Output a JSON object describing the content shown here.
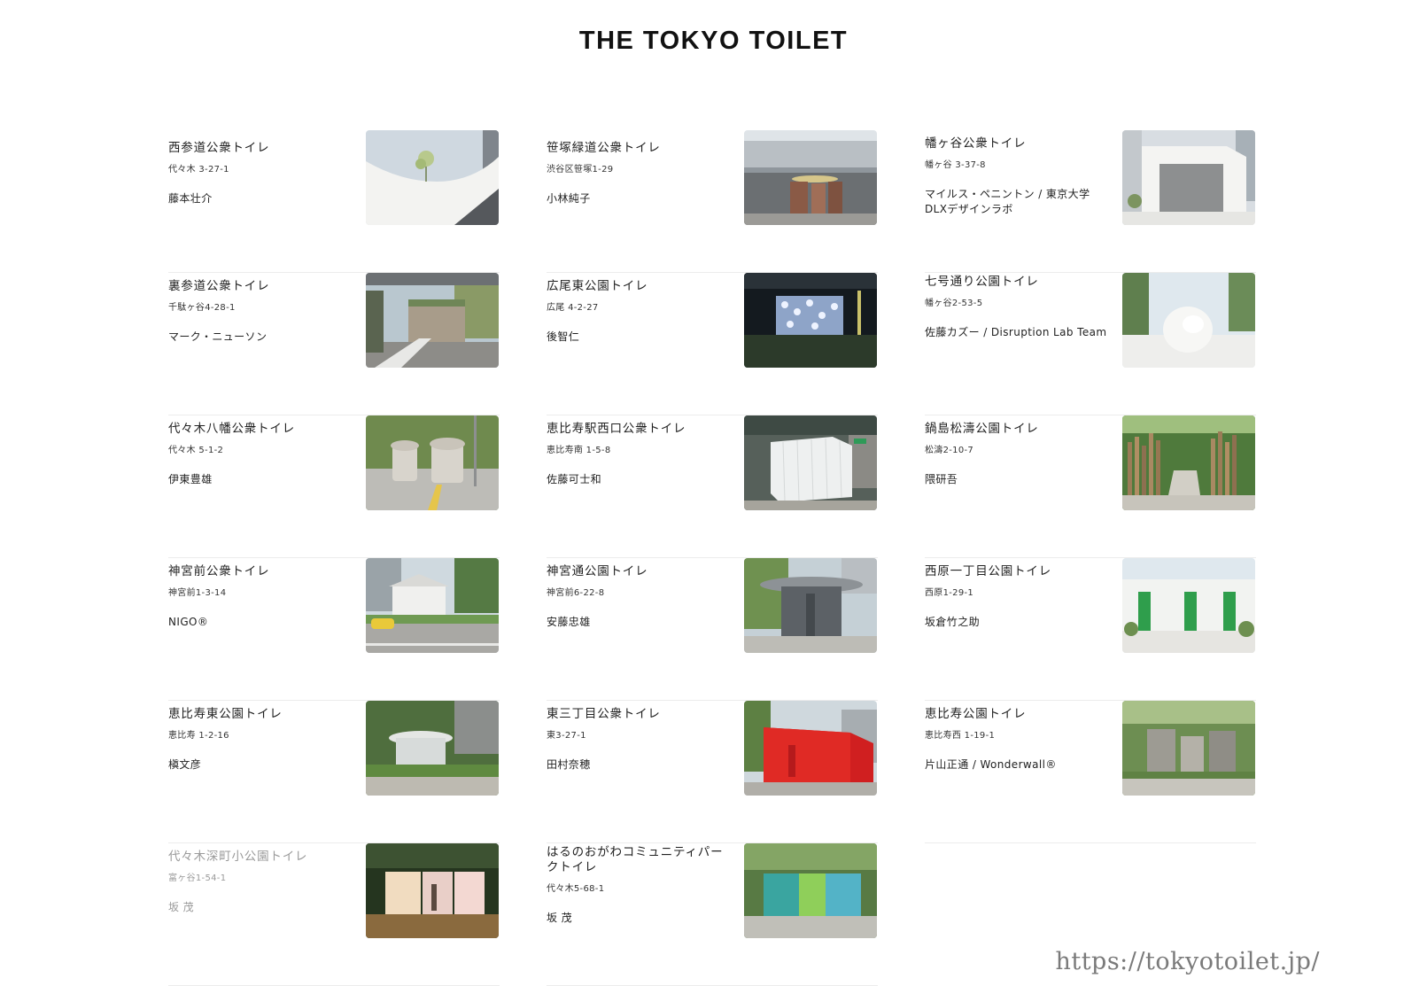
{
  "site": {
    "title": "THE TOKYO TOILET"
  },
  "toilets": [
    {
      "name": "西参道公衆トイレ",
      "address": "代々木 3-27-1",
      "designer": "藤本壮介",
      "photo": "white-wave-structure-photo"
    },
    {
      "name": "笹塚緑道公衆トイレ",
      "address": "渋谷区笹塚1-29",
      "designer": "小林純子",
      "photo": "under-overpass-photo"
    },
    {
      "name": "幡ヶ谷公衆トイレ",
      "address": "幡ヶ谷 3-37-8",
      "designer": "マイルス・ペニントン / 東京大学 DLXデザインラボ",
      "photo": "white-cube-frame-photo"
    },
    {
      "name": "裏参道公衆トイレ",
      "address": "千駄ヶ谷4-28-1",
      "designer": "マーク・ニューソン",
      "photo": "green-roof-house-photo"
    },
    {
      "name": "広尾東公園トイレ",
      "address": "広尾 4-2-27",
      "designer": "後智仁",
      "photo": "night-lit-box-photo"
    },
    {
      "name": "七号通り公園トイレ",
      "address": "幡ヶ谷2-53-5",
      "designer": "佐藤カズー / Disruption Lab Team",
      "photo": "white-dome-photo"
    },
    {
      "name": "代々木八幡公衆トイレ",
      "address": "代々木 5-1-2",
      "designer": "伊東豊雄",
      "photo": "mushroom-huts-photo"
    },
    {
      "name": "恵比寿駅西口公衆トイレ",
      "address": "恵比寿南 1-5-8",
      "designer": "佐藤可士和",
      "photo": "white-louver-cube-photo"
    },
    {
      "name": "鍋島松濤公園トイレ",
      "address": "松濤2-10-7",
      "designer": "隈研吾",
      "photo": "wooden-slats-photo"
    },
    {
      "name": "神宮前公衆トイレ",
      "address": "神宮前1-3-14",
      "designer": "NIGO®",
      "photo": "street-house-taxi-photo"
    },
    {
      "name": "神宮通公園トイレ",
      "address": "神宮前6-22-8",
      "designer": "安藤忠雄",
      "photo": "cylinder-canopy-photo"
    },
    {
      "name": "西原一丁目公園トイレ",
      "address": "西原1-29-1",
      "designer": "坂倉竹之助",
      "photo": "white-wall-green-doors-photo"
    },
    {
      "name": "恵比寿東公園トイレ",
      "address": "恵比寿 1-2-16",
      "designer": "槇文彦",
      "photo": "park-pavilion-photo"
    },
    {
      "name": "東三丁目公衆トイレ",
      "address": "東3-27-1",
      "designer": "田村奈穂",
      "photo": "red-box-photo"
    },
    {
      "name": "恵比寿公園トイレ",
      "address": "恵比寿西 1-19-1",
      "designer": "片山正通 / Wonderwall®",
      "photo": "concrete-walls-photo"
    },
    {
      "name": "代々木深町小公園トイレ",
      "address": "富ヶ谷1-54-1",
      "designer": "坂 茂",
      "photo": "transparent-glow-photo"
    },
    {
      "name": "はるのおがわコミュニティパークトイレ",
      "address": "代々木5-68-1",
      "designer": "坂 茂",
      "photo": "transparent-color-glass-photo"
    }
  ],
  "watermark": "https://tokyotoilet.jp/"
}
